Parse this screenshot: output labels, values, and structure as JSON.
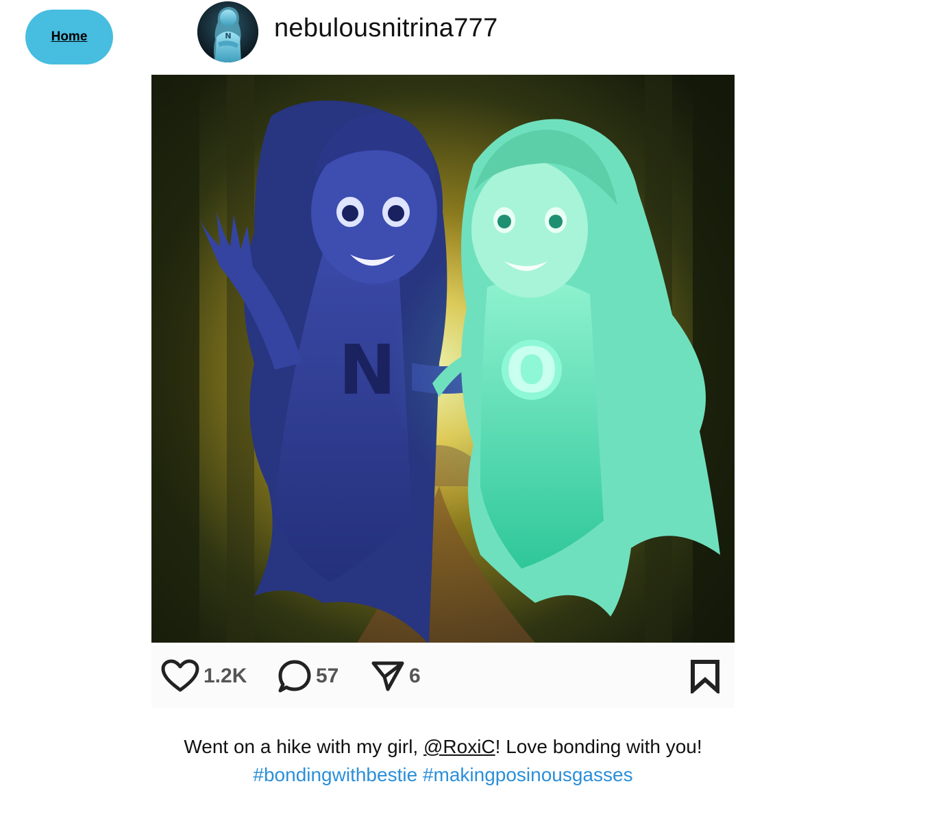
{
  "nav": {
    "home_label": "Home"
  },
  "profile": {
    "username": "nebulousnitrina777",
    "avatar_icon": "ghost-avatar-n",
    "avatar_letter": "N"
  },
  "post": {
    "image_icon": "two-ghost-girls-forest-illustration",
    "figure_letters": {
      "left": "N",
      "right": "O"
    },
    "likes": "1.2K",
    "comments": "57",
    "shares": "6",
    "icons": {
      "like": "heart-icon",
      "comment": "comment-bubble-icon",
      "share": "send-icon",
      "save": "bookmark-icon"
    },
    "caption": {
      "before": "Went on a hike with my girl, ",
      "mention": "@RoxiC",
      "after": "! Love bonding with you!",
      "hashtags": [
        "#bondingwithbestie",
        "#makingposinousgasses"
      ]
    }
  },
  "colors": {
    "home_button": "#47bde0",
    "hashtag": "#2b8fd8",
    "left_ghost": "#2c3a8f",
    "right_ghost": "#3fd6a8"
  }
}
